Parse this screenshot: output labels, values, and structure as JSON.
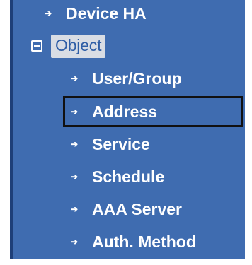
{
  "nav": {
    "items": [
      {
        "label": "Device HA",
        "icon": "arrow-right-icon"
      },
      {
        "label": "Object",
        "icon": "collapse-minus-icon",
        "expanded": true,
        "selected": true
      },
      {
        "label": "User/Group",
        "icon": "arrow-right-icon"
      },
      {
        "label": "Address",
        "icon": "arrow-right-icon",
        "highlighted": true
      },
      {
        "label": "Service",
        "icon": "arrow-right-icon"
      },
      {
        "label": "Schedule",
        "icon": "arrow-right-icon"
      },
      {
        "label": "AAA Server",
        "icon": "arrow-right-icon"
      },
      {
        "label": "Auth. Method",
        "icon": "arrow-right-icon"
      }
    ]
  },
  "colors": {
    "panel_bg": "#3f6cb0",
    "panel_border": "#1e3f78",
    "text": "#ffffff",
    "selected_bg": "#d9dde4",
    "highlight_border": "#111111"
  }
}
